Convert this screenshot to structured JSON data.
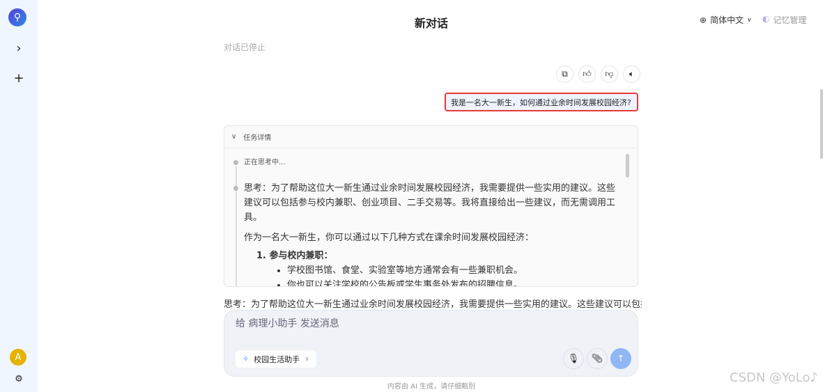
{
  "sidebar": {
    "avatar": "A",
    "expand_icon": "›",
    "new_icon": "+"
  },
  "header": {
    "title": "新对话",
    "language": "简体中文",
    "memory": "记忆管理"
  },
  "status": "对话已停止",
  "user_message": "我是一名大一新生，如何通过业余时间发展校园经济?",
  "task": {
    "title": "任务详情",
    "thinking": "正在思考中...",
    "thought": "思考：为了帮助这位大一新生通过业余时间发展校园经济，我需要提供一些实用的建议。这些建议可以包括参与校内兼职、创业项目、二手交易等。我将直接给出一些建议，而无需调用工具。",
    "intro": "作为一名大一新生，你可以通过以下几种方式在课余时间发展校园经济：",
    "item1_title": "1. 参与校内兼职：",
    "item1_points": [
      "学校图书馆、食堂、实验室等地方通常会有一些兼职机会。",
      "你也可以关注学校的公告板或学生事务处发布的招聘信息。"
    ]
  },
  "answer_preview": "思考：为了帮助这位大一新生通过业余时间发展校园经济，我需要提供一些实用的建议。这些建议可以包括参",
  "input": {
    "placeholder": "给 病理小助手 发送消息",
    "agent": "校园生活助手"
  },
  "footer": "内容由 AI 生成，请仔细甄别",
  "watermark": "CSDN @YoLo♪"
}
